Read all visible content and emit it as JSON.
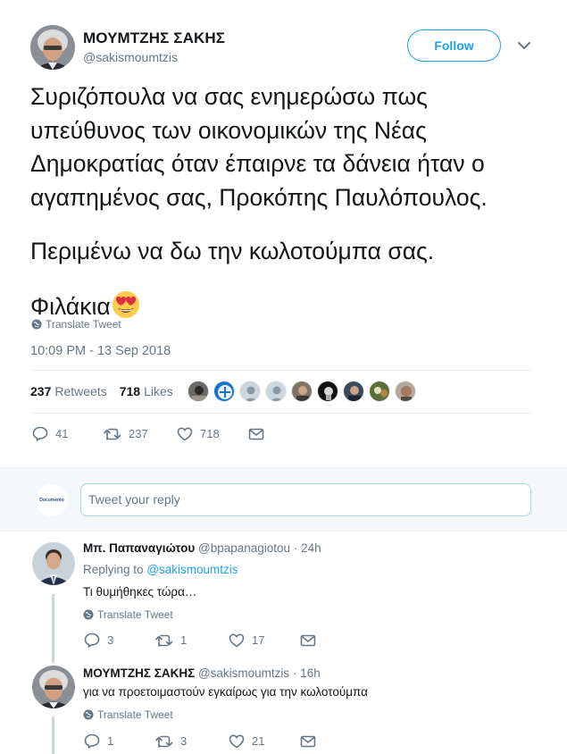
{
  "tweet": {
    "author_name": "ΜΟΥΜΤΖΗΣ ΣΑΚΗΣ",
    "author_handle": "@sakismoumtzis",
    "follow_label": "Follow",
    "text_lines": [
      "Συριζόπουλα να σας ενημερώσω πως",
      "υπεύθυνος των οικονομικών της Νέας",
      "Δημοκρατίας όταν έπαιρνε τα δάνεια ήταν ο",
      "αγαπημένος σας, Προκόπης Παυλόπουλος."
    ],
    "text_line_2": "Περιμένω να δω την κωλοτούμπα σας.",
    "text_line_3": "Φιλάκια",
    "emoji": "heart-eyes-emoji",
    "translate_label": "Translate Tweet",
    "timestamp": "10:09 PM - 13 Sep 2018",
    "retweets_count": "237",
    "retweets_label": "Retweets",
    "likes_count": "718",
    "likes_label": "Likes",
    "actions": {
      "replies": "41",
      "retweets": "237",
      "likes": "718"
    }
  },
  "reply_box": {
    "avatar_text": "Documento",
    "placeholder": "Tweet your reply"
  },
  "replies": [
    {
      "name": "Μπ. Παπαναγιώτου",
      "handle": "@bpapanagiotou",
      "time": "· 24h",
      "replying_to_label": "Replying to",
      "replying_to_handle": "@sakismoumtzis",
      "text": "Τι θυμήθηκες τώρα…",
      "translate_label": "Translate Tweet",
      "replies": "3",
      "retweets": "1",
      "likes": "17"
    },
    {
      "name": "ΜΟΥΜΤΖΗΣ ΣΑΚΗΣ",
      "handle": "@sakismoumtzis",
      "time": "· 16h",
      "text": "για να προετοιμαστούν εγκαίρως για την κωλοτούμπα",
      "translate_label": "Translate Tweet",
      "replies": "1",
      "retweets": "3",
      "likes": "21"
    }
  ],
  "colors": {
    "accent": "#1da1f2",
    "secondary_text": "#657786",
    "divider": "#e6ecf0"
  }
}
